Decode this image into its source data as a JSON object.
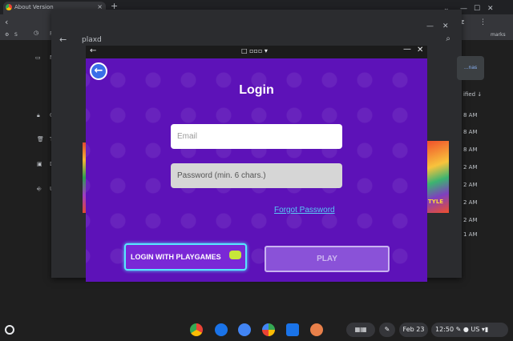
{
  "chrome": {
    "tab_title": "About Version",
    "tab_close": "×",
    "new_tab": "+",
    "history_label": "R",
    "bookmarks_label": "marks",
    "sidebar_letters": [
      "M",
      "G",
      "T",
      "D",
      "U"
    ]
  },
  "store": {
    "search_query": "plaxd",
    "manage_label": "...nas",
    "sort_label": "ified ↓",
    "times": [
      "8 AM",
      "8 AM",
      "8 AM",
      "2 AM",
      "2 AM",
      "2 AM",
      "2 AM",
      "1 AM"
    ],
    "thumb_text": "TYLE"
  },
  "app": {
    "title_mid": "□ ▫▫▫ ▾",
    "login_title": "Login",
    "email_placeholder": "Email",
    "password_placeholder": "Password (min. 6 chars.)",
    "forgot_password": "Forgot Password",
    "login_playgames": "LOGIN WITH PLAYGAMES",
    "play": "PLAY"
  },
  "shelf": {
    "date": "Feb 23",
    "time": "12:50",
    "locale": "US"
  },
  "colors": {
    "app_background": "#5d12b8",
    "accent_cyan": "#58e6ff",
    "link": "#58c8f5"
  }
}
